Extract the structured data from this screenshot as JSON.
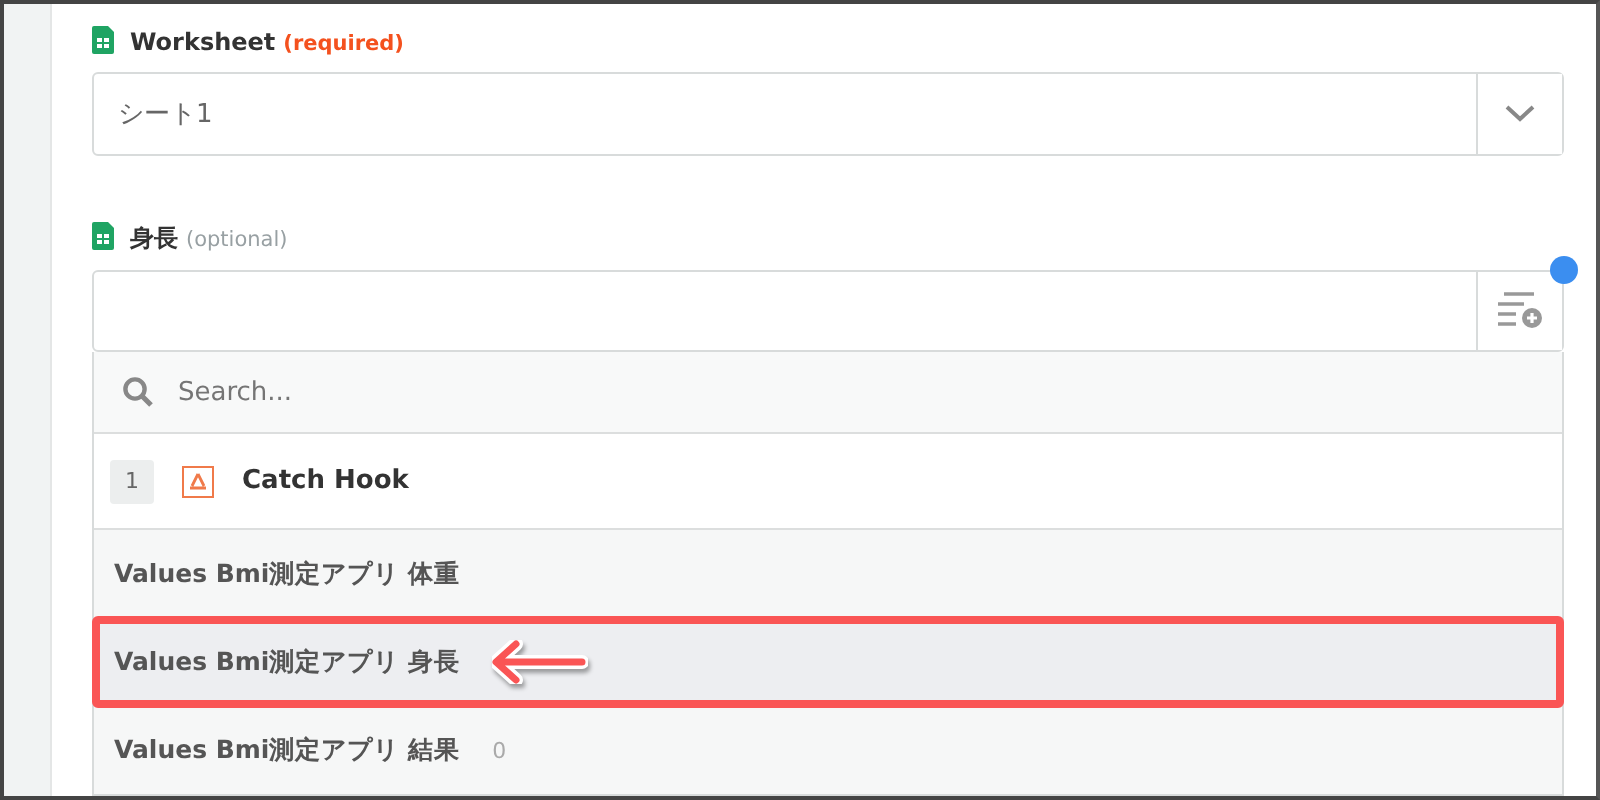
{
  "fields": [
    {
      "label": "Worksheet",
      "hint": "(required)",
      "required": true,
      "kind": "select",
      "value": "シート1"
    },
    {
      "label": "身長",
      "hint": "(optional)",
      "required": false,
      "kind": "input"
    }
  ],
  "dropdown": {
    "search_placeholder": "Search...",
    "step": {
      "number": "1",
      "name": "Catch Hook"
    },
    "options": [
      {
        "label": "Values Bmi測定アプリ 体重",
        "selected": false
      },
      {
        "label": "Values Bmi測定アプリ 身長",
        "selected": true
      },
      {
        "label": "Values Bmi測定アプリ 結果",
        "sample": "0",
        "selected": false
      }
    ]
  }
}
